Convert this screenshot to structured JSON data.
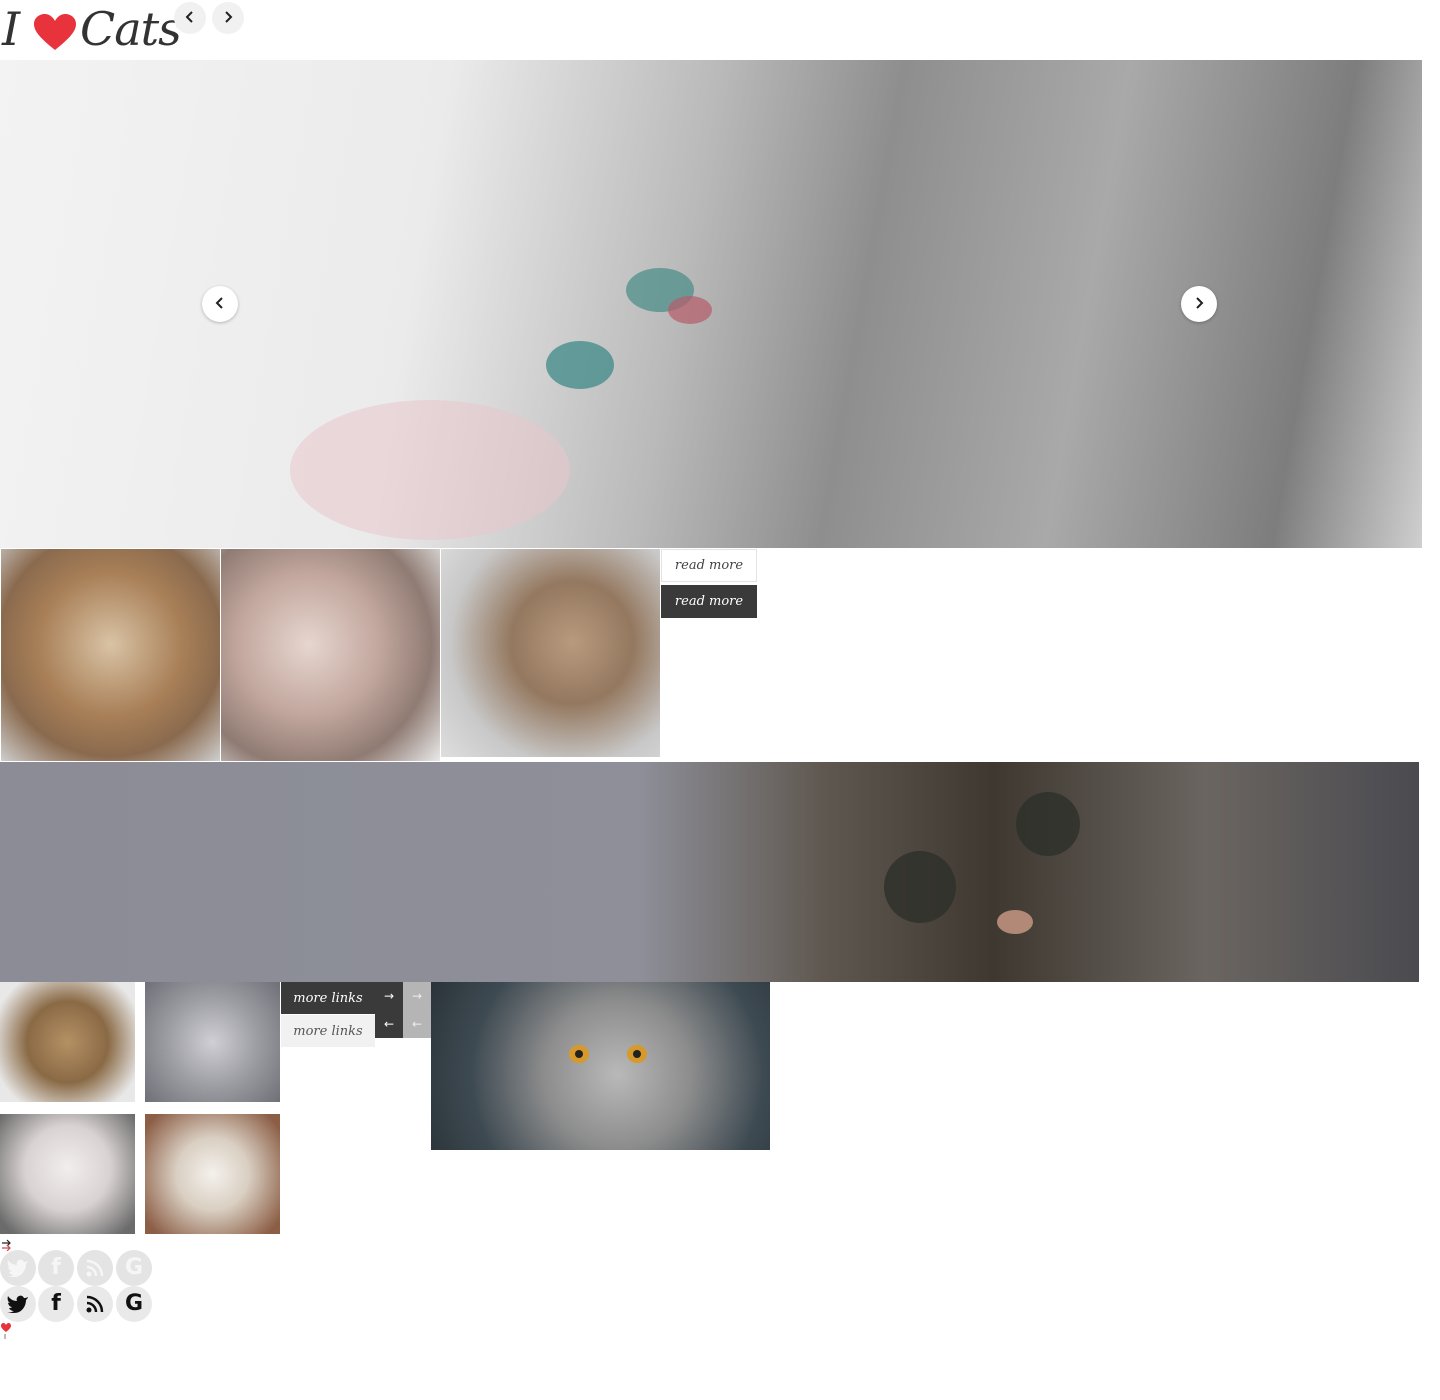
{
  "header": {
    "logo": {
      "text_i": "I",
      "text_cats": "Cats",
      "heart_icon": "heart-icon"
    },
    "prev_icon": "chevron-left-icon",
    "next_icon": "chevron-right-icon"
  },
  "hero": {
    "prev_icon": "chevron-left-icon",
    "next_icon": "chevron-right-icon"
  },
  "gallery_row": {
    "read_more_light": "read more",
    "read_more_dark": "read more"
  },
  "more_links": {
    "dark_label": "more links",
    "light_label": "more links",
    "arrow_right": "→",
    "arrow_left": "←"
  },
  "social": {
    "icons": [
      "twitter-icon",
      "facebook-icon",
      "rss-icon",
      "google-icon"
    ],
    "facebook_glyph": "f",
    "google_glyph": "G"
  },
  "colors": {
    "accent_heart": "#e8323c",
    "dark_button": "#3a3a3a",
    "light_button": "#f1f1f1"
  }
}
